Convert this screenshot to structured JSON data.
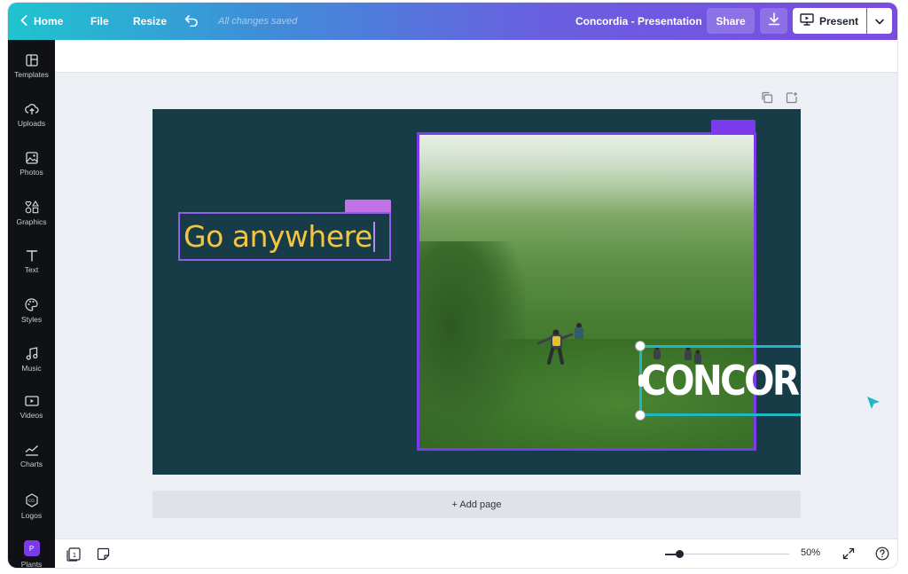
{
  "topbar": {
    "home_label": "Home",
    "file_label": "File",
    "resize_label": "Resize",
    "status": "All changes saved",
    "doc_title": "Concordia - Presentation",
    "share_label": "Share",
    "present_label": "Present"
  },
  "sidebar": {
    "items": [
      {
        "label": "Templates",
        "icon": "templates-icon"
      },
      {
        "label": "Uploads",
        "icon": "upload-cloud-icon"
      },
      {
        "label": "Photos",
        "icon": "image-icon"
      },
      {
        "label": "Graphics",
        "icon": "shapes-icon"
      },
      {
        "label": "Text",
        "icon": "text-t-icon"
      },
      {
        "label": "Styles",
        "icon": "palette-icon"
      },
      {
        "label": "Music",
        "icon": "music-note-icon"
      },
      {
        "label": "Videos",
        "icon": "video-icon"
      },
      {
        "label": "Charts",
        "icon": "line-chart-icon"
      },
      {
        "label": "Logos",
        "icon": "logo-badge-icon"
      },
      {
        "label": "Plants",
        "icon": "folder-badge-icon",
        "badge": "P"
      }
    ]
  },
  "slide": {
    "heading_text": "Go anywhere",
    "logo_text": "CONCORDIA",
    "background_color": "#173c47",
    "heading_color": "#f4c542",
    "accent_color": "#7c3aed",
    "selection_color": "#1fb7c4"
  },
  "canvas": {
    "add_page_label": "+ Add page"
  },
  "bottombar": {
    "page_number": "1",
    "zoom": "50%",
    "zoom_level": 0.5
  }
}
